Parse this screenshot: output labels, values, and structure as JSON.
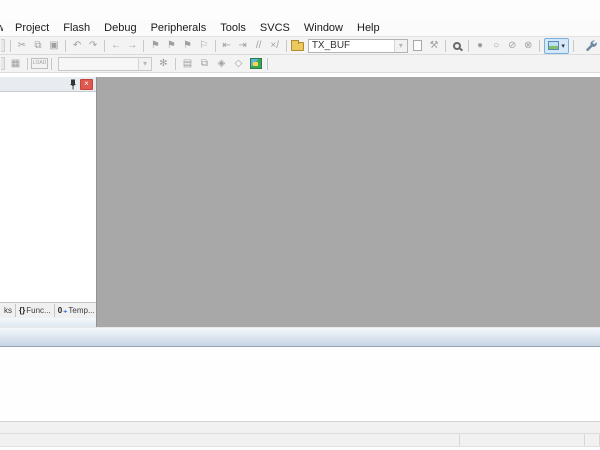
{
  "menu": {
    "clipped": "w",
    "items": [
      "Project",
      "Flash",
      "Debug",
      "Peripherals",
      "Tools",
      "SVCS",
      "Window",
      "Help"
    ]
  },
  "toolbar_main": {
    "find_value": "TX_BUF",
    "glyphs": {
      "cut": "✂",
      "copy": "⧉",
      "paste": "▣",
      "undo": "↶",
      "redo": "↷",
      "nav_back": "←",
      "nav_forward": "→",
      "bookmark_toggle": "⚑",
      "bookmark_prev": "⚑",
      "bookmark_next": "⚑",
      "bookmark_clear": "⚐",
      "indent_left": "⇤",
      "indent_right": "⇥",
      "comment": "//",
      "uncomment": "×/",
      "find_tools": "⚒",
      "breakpoint_toggle": "●",
      "breakpoint_enable": "○",
      "breakpoint_disable_all": "⊘",
      "breakpoint_kill_all": "⊗",
      "dropdown_arrow": "▾"
    }
  },
  "toolbar_build": {
    "target_value": "",
    "load_label": "LOAD",
    "glyphs": {
      "batch_build": "▦",
      "options_wand": "✻",
      "manage_items": "▤",
      "multi_window": "⧉",
      "rte_diamond": "◈",
      "packs_diamond": "◇"
    }
  },
  "left_panel": {
    "close_glyph": "×",
    "tabs": [
      {
        "label": "ks"
      },
      {
        "icon": "{}",
        "label": "Func..."
      },
      {
        "icon": "0",
        "plus": "₊",
        "label": "Temp..."
      }
    ]
  },
  "colors": {
    "workspace_gray": "#a8a8a8",
    "close_button_red": "#e0574e",
    "caption_gradient_top": "#f4f8fc",
    "caption_gradient_bottom": "#c6d4e3",
    "highlight_button_bg": "#d5e8fa",
    "highlight_button_border": "#79aede",
    "folder_yellow": "#ecc95f",
    "pack_green": "#3aa655",
    "wrench_blue": "#7089a5"
  }
}
